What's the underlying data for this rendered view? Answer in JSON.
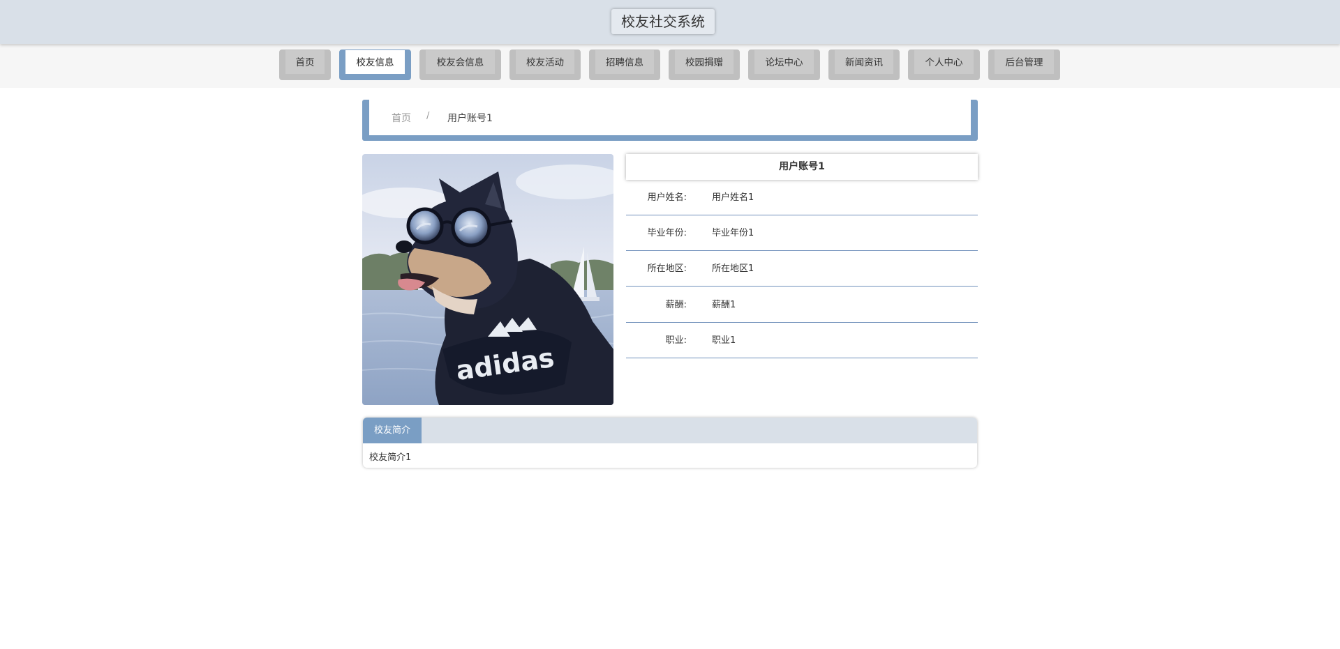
{
  "header": {
    "title": "校友社交系统"
  },
  "nav": {
    "items": [
      {
        "label": "首页"
      },
      {
        "label": "校友信息",
        "active": true
      },
      {
        "label": "校友会信息"
      },
      {
        "label": "校友活动"
      },
      {
        "label": "招聘信息"
      },
      {
        "label": "校园捐赠"
      },
      {
        "label": "论坛中心"
      },
      {
        "label": "新闻资讯"
      },
      {
        "label": "个人中心"
      },
      {
        "label": "后台管理"
      }
    ]
  },
  "breadcrumb": {
    "home": "首页",
    "separator": "/",
    "current": "用户账号1"
  },
  "profile": {
    "photo_alt": "shiba-dog-with-sunglasses",
    "account": "用户账号1",
    "fields": [
      {
        "label": "用户姓名:",
        "value": "用户姓名1"
      },
      {
        "label": "毕业年份:",
        "value": "毕业年份1"
      },
      {
        "label": "所在地区:",
        "value": "所在地区1"
      },
      {
        "label": "薪酬:",
        "value": "薪酬1"
      },
      {
        "label": "职业:",
        "value": "职业1"
      }
    ]
  },
  "intro": {
    "tab_label": "校友简介",
    "content": "校友简介1"
  },
  "colors": {
    "accent": "#7a9ec4",
    "header_bg": "#d9e0e8",
    "nav_bg": "#f6f6f6",
    "button_gray": "#bfbfbf"
  }
}
